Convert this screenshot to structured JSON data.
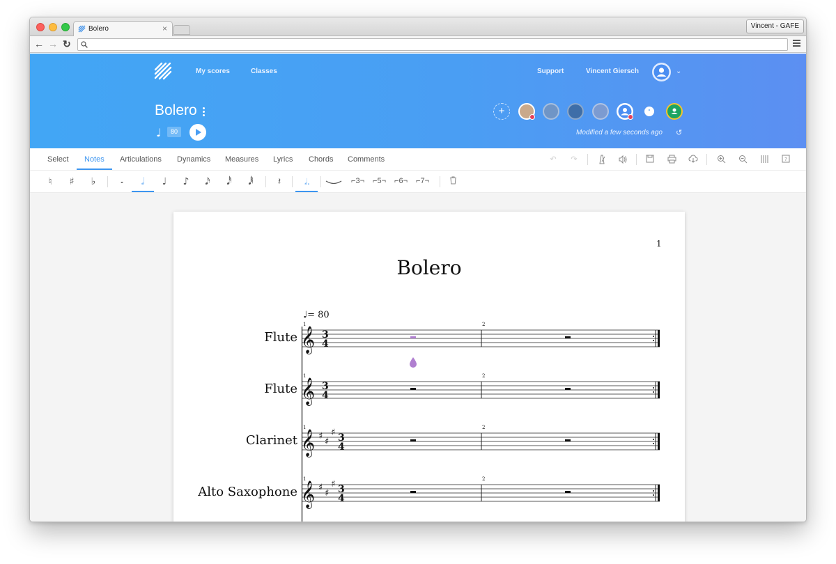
{
  "browser": {
    "tab_title": "Bolero",
    "profile": "Vincent - GAFE",
    "url": ""
  },
  "header": {
    "nav": [
      "My scores",
      "Classes"
    ],
    "support": "Support",
    "user_name": "Vincent Giersch",
    "score_title": "Bolero",
    "tempo": "80",
    "modified": "Modified a few seconds ago",
    "accent_color": "#42a6f5"
  },
  "toolbar": {
    "tabs": [
      "Select",
      "Notes",
      "Articulations",
      "Dynamics",
      "Measures",
      "Lyrics",
      "Chords",
      "Comments"
    ],
    "active_tab": "Notes",
    "right_icons": [
      "undo-icon",
      "redo-icon",
      "metronome-icon",
      "sound-icon",
      "save-icon",
      "print-icon",
      "cloud-icon",
      "zoom-in-icon",
      "zoom-out-icon",
      "layout-icon",
      "help-icon"
    ]
  },
  "palette": {
    "accidentals": [
      "♮",
      "♯",
      "♭"
    ],
    "durations": [
      "𝅝",
      "𝅗𝅥",
      "♩",
      "♪",
      "𝅘𝅥𝅯",
      "𝅘𝅥𝅰",
      "𝅘𝅥𝅱"
    ],
    "active_duration": "𝅗𝅥",
    "rest": "𝄽",
    "tuplets": [
      "3",
      "5",
      "6",
      "7"
    ]
  },
  "score": {
    "page_number": "1",
    "title": "Bolero",
    "tempo_marking": "= 80",
    "time_signature": [
      "3",
      "4"
    ],
    "measure_numbers": [
      "1",
      "2"
    ],
    "instruments": [
      "Flute",
      "Flute",
      "Clarinet",
      "Alto Saxophone"
    ],
    "cursor_color": "#b07fd0"
  }
}
